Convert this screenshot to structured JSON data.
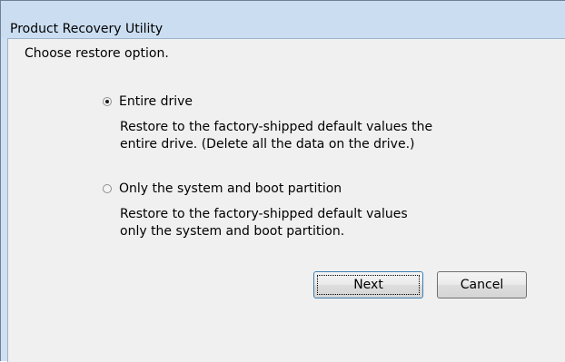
{
  "window": {
    "title": "Product Recovery Utility"
  },
  "dialog": {
    "prompt": "Choose restore option.",
    "options": [
      {
        "label": "Entire drive",
        "checked": true,
        "description_line1": "Restore to the factory-shipped default values the",
        "description_line2": "entire drive. (Delete all the data on the drive.)"
      },
      {
        "label": "Only the system and boot partition",
        "checked": false,
        "description_line1": "Restore to the factory-shipped default values",
        "description_line2": "only the system and boot partition."
      }
    ],
    "buttons": {
      "next_label": "Next",
      "cancel_label": "Cancel"
    }
  },
  "colors": {
    "titlebar": "#cbdef1",
    "client_background": "#f0f0f0",
    "default_button_border": "#3c7fb1"
  }
}
